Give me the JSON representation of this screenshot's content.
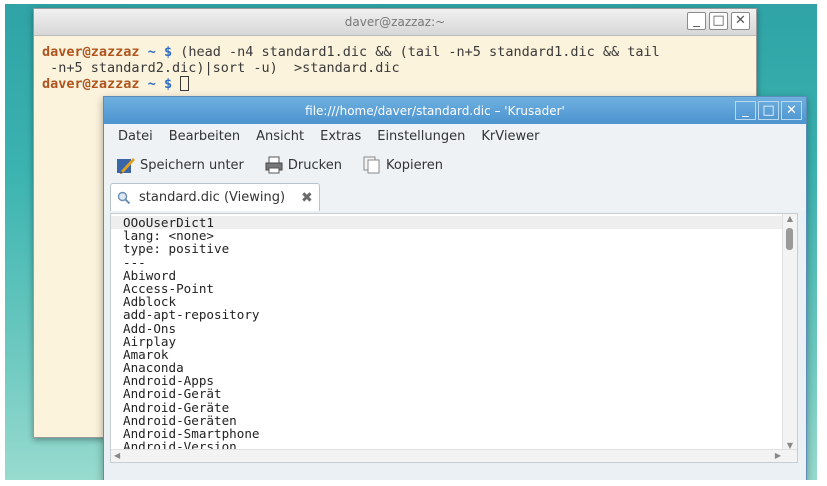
{
  "terminal": {
    "title": "daver@zazzaz:~",
    "lines": [
      {
        "user": "daver",
        "at": "@",
        "host": "zazzaz",
        "path": " ~ $",
        "cmd": " (head -n4 standard1.dic && (tail -n+5 standard1.dic && tail"
      },
      {
        "text": " -n+5 standard2.dic)|sort -u)  >standard.dic"
      },
      {
        "user": "daver",
        "at": "@",
        "host": "zazzaz",
        "path": " ~ $",
        "cmd": " "
      }
    ],
    "buttons": {
      "minimize": "_",
      "maximize": "□",
      "close": "✕"
    }
  },
  "krusader": {
    "title": "file:///home/daver/standard.dic – 'Krusader'",
    "buttons": {
      "minimize": "_",
      "maximize": "□",
      "close": "✕"
    },
    "menu": [
      "Datei",
      "Bearbeiten",
      "Ansicht",
      "Extras",
      "Einstellungen",
      "KrViewer"
    ],
    "toolbar": {
      "save_as": "Speichern unter",
      "print": "Drucken",
      "copy": "Kopieren"
    },
    "tab": {
      "label": "standard.dic (Viewing)",
      "close": "✖"
    },
    "viewer_lines": [
      "OOoUserDict1",
      "lang: <none>",
      "type: positive",
      "---",
      "Abiword",
      "Access-Point",
      "Adblock",
      "add-apt-repository",
      "Add-Ons",
      "Airplay",
      "Amarok",
      "Anaconda",
      "Android-Apps",
      "Android-Gerät",
      "Android-Geräte",
      "Android-Geräten",
      "Android-Smartphone",
      "Android-Version"
    ]
  },
  "icons": {
    "save_as": "save-as-icon",
    "print": "printer-icon",
    "copy": "copy-icon",
    "tab": "magnifier-icon"
  }
}
